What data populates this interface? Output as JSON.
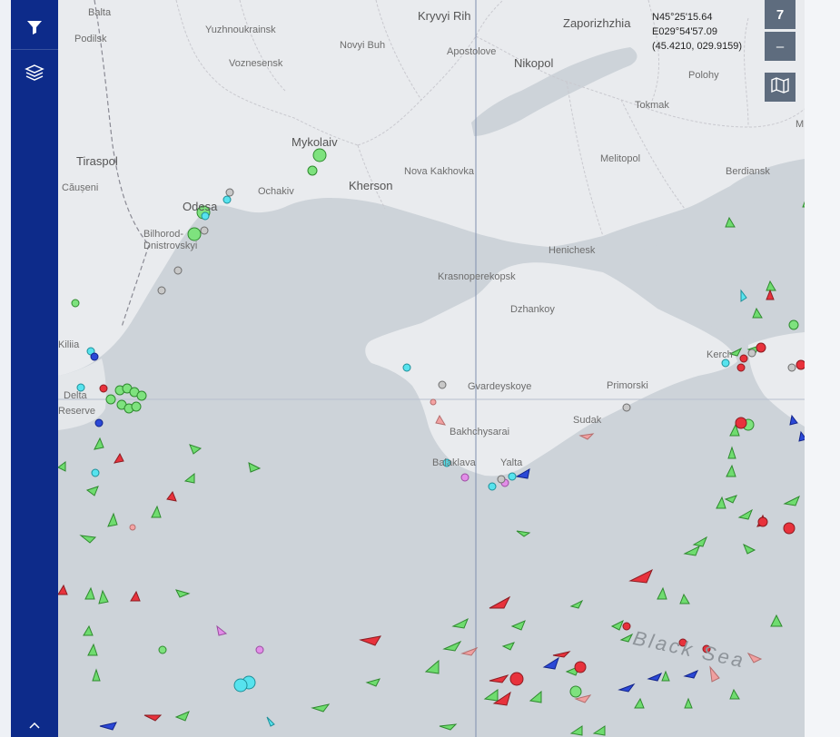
{
  "sidebar": {
    "items": [
      {
        "icon": "filter-icon",
        "label": "Filters"
      },
      {
        "icon": "layers-icon",
        "label": "Layers"
      }
    ],
    "bg": "#0d2b8a"
  },
  "map": {
    "coords": {
      "lat": "N45°25'15.64",
      "lon": "E029°54'57.09",
      "decimal": "(45.4210, 029.9159)"
    },
    "zoom": {
      "level": "7",
      "minus": "–"
    },
    "places": [
      "Balta",
      "Podilsk",
      "Yuzhnoukrainsk",
      "Novyi Buh",
      "Kryvyi Rih",
      "Zaporizhzhia",
      "Voznesensk",
      "Apostolove",
      "Nikopol",
      "Polohy",
      "Tokmak",
      "Mykolaiv",
      "Tiraspol",
      "Căușeni",
      "Odesa",
      "Ochakiv",
      "Kherson",
      "Nova Kakhovka",
      "Melitopol",
      "Berdiansk",
      "Bilhorod-Dnistrovskyi",
      "Henichesk",
      "Krasnoperekopsk",
      "Dzhankoy",
      "Kerch",
      "Kiliia",
      "Gvardeyskoye",
      "Primorski",
      "Sudak",
      "Bakhchysarai",
      "Yalta",
      "Balaklava",
      "Delta",
      "Reserve",
      "M"
    ],
    "sea_label": "Black Sea"
  }
}
